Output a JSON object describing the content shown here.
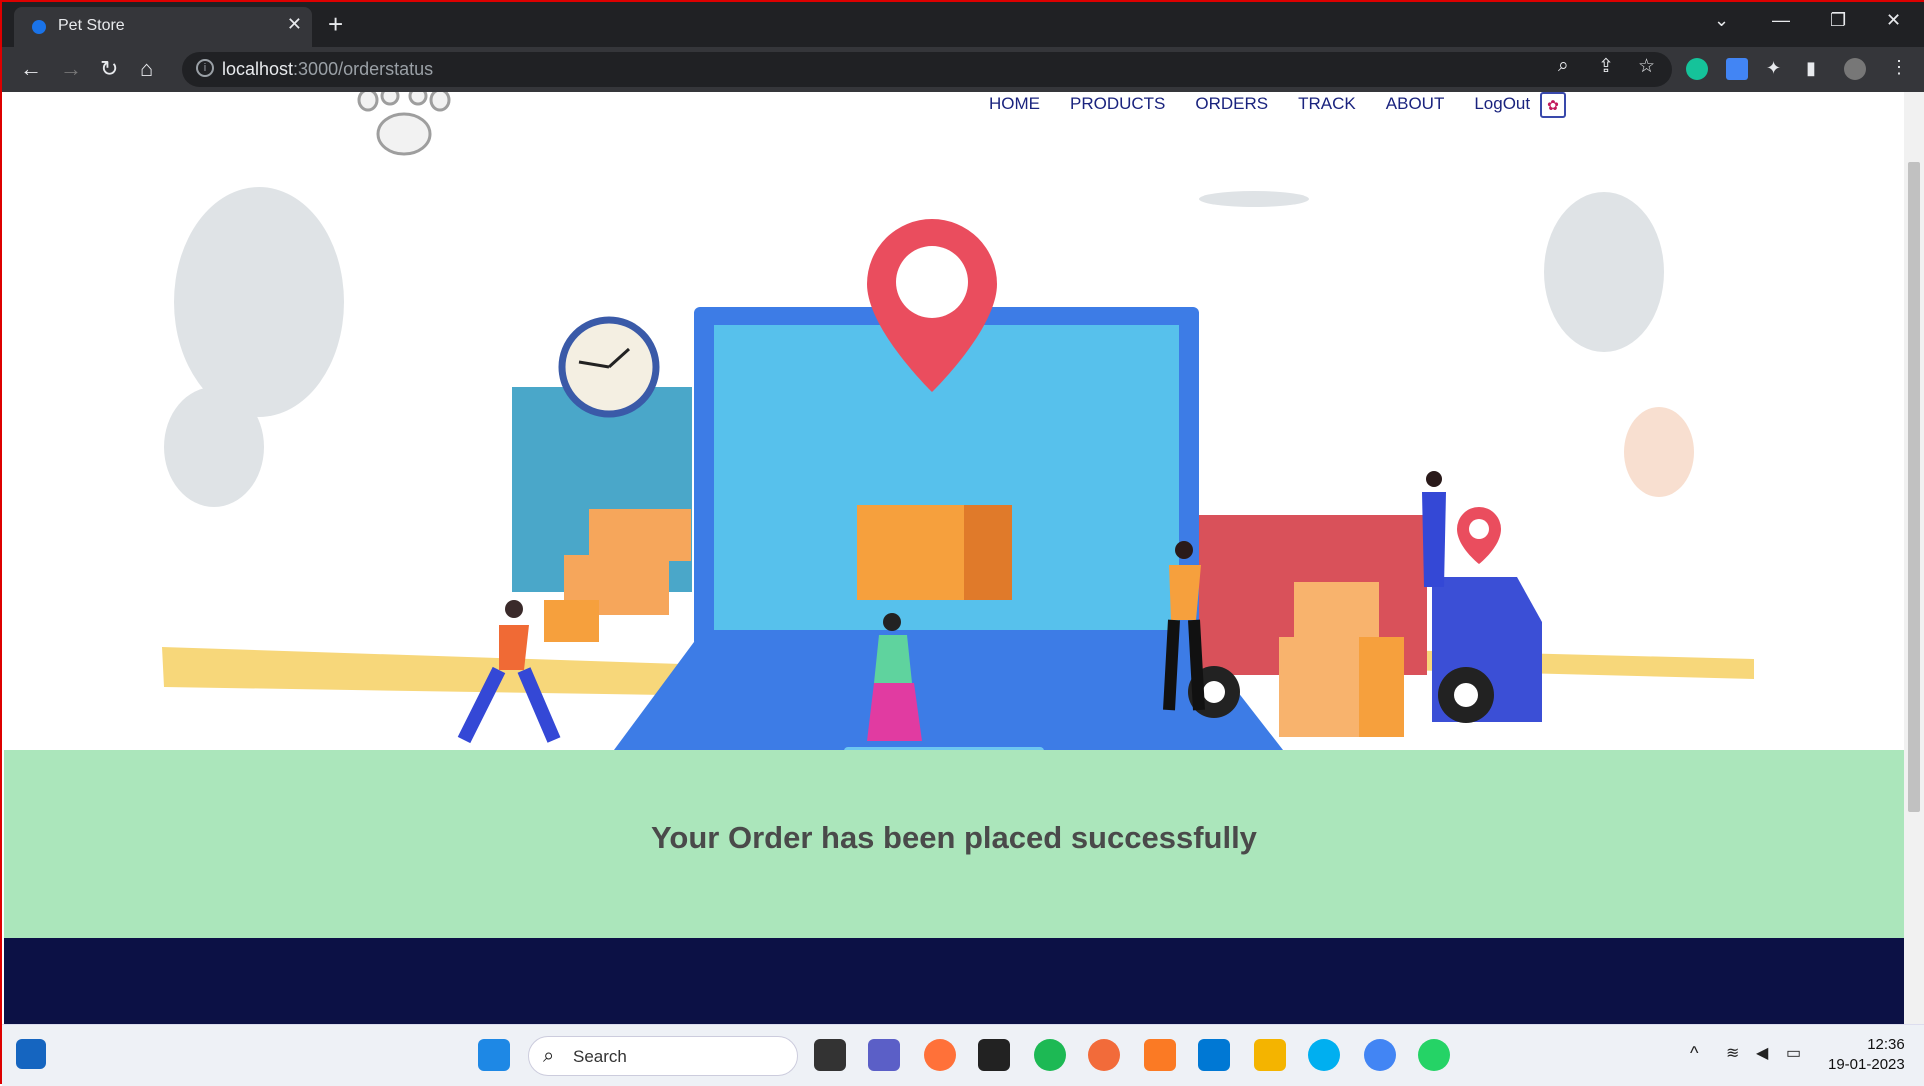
{
  "browser": {
    "tab_title": "Pet Store",
    "url_host": "localhost",
    "url_rest": ":3000/orderstatus"
  },
  "nav": {
    "items": [
      "HOME",
      "PRODUCTS",
      "ORDERS",
      "TRACK",
      "ABOUT",
      "LogOut"
    ]
  },
  "main": {
    "success_message": "Your Order has been placed successfully"
  },
  "taskbar": {
    "search_label": "Search",
    "time": "12:36",
    "date": "19-01-2023"
  },
  "colors": {
    "success_bg": "#abe6bb",
    "footer_bg": "#0c1145",
    "nav_text": "#1a237e"
  }
}
